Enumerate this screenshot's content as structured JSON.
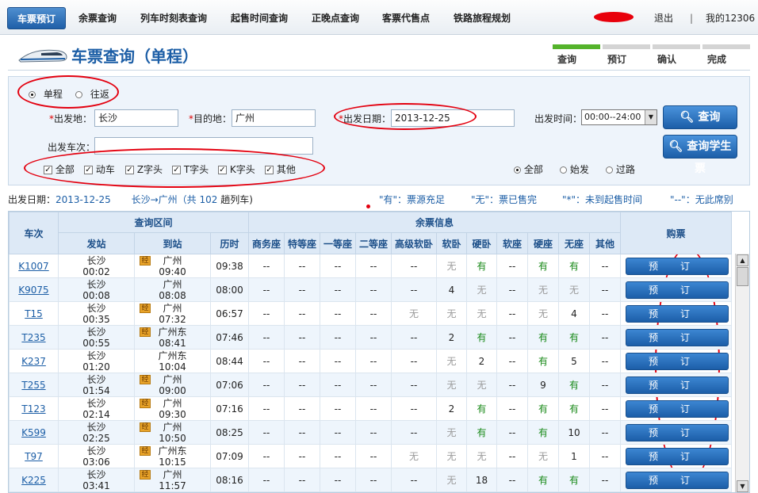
{
  "nav": {
    "items": [
      "车票预订",
      "余票查询",
      "列车时刻表查询",
      "起售时间查询",
      "正晚点查询",
      "客票代售点",
      "铁路旅程规划"
    ],
    "logout": "退出",
    "separator": "|",
    "my12306": "我的12306"
  },
  "page": {
    "title": "车票查询（单程）"
  },
  "steps": [
    "查询",
    "预订",
    "确认",
    "完成"
  ],
  "form": {
    "trip_oneway": "单程",
    "trip_round": "往返",
    "from_label": "出发地：",
    "from_value": "长沙",
    "to_label": "目的地：",
    "to_value": "广州",
    "date_label": "出发日期：",
    "date_value": "2013-12-25",
    "time_label": "出发时间：",
    "time_value": "00:00--24:00",
    "train_no_label": "出发车次：",
    "train_no_value": "",
    "types": [
      "全部",
      "动车",
      "Z字头",
      "T字头",
      "K字头",
      "其他"
    ],
    "station_all": "全部",
    "station_start": "始发",
    "station_pass": "过路",
    "query_button": "查询",
    "student_button": "查询学生票"
  },
  "summary": {
    "date_label": "出发日期：",
    "date": "2013-12-25",
    "route": "长沙→广州（共",
    "count": "102",
    "trains_suffix": "趟列车)"
  },
  "legend": [
    "\"有\"：票源充足",
    "\"无\"：票已售完",
    "\"*\"：未到起售时间",
    "\"--\"：无此席别"
  ],
  "table": {
    "header_query": "查询区间",
    "header_seats": "余票信息",
    "header_train": "车次",
    "header_buy": "购票",
    "cols": [
      "发站",
      "到站",
      "历时",
      "商务座",
      "特等座",
      "一等座",
      "二等座",
      "高级软卧",
      "软卧",
      "硬卧",
      "软座",
      "硬座",
      "无座",
      "其他"
    ],
    "book_label": "预订",
    "via_mark": "经",
    "rows": [
      {
        "no": "K1007",
        "from": "长沙",
        "dep": "00:02",
        "to": "广州",
        "arr": "09:40",
        "dur": "09:38",
        "via": true,
        "seats": [
          "--",
          "--",
          "--",
          "--",
          "--",
          "无",
          "有",
          "--",
          "有",
          "有",
          "--"
        ]
      },
      {
        "no": "K9075",
        "from": "长沙",
        "dep": "00:08",
        "to": "广州",
        "arr": "08:08",
        "dur": "08:00",
        "via": false,
        "seats": [
          "--",
          "--",
          "--",
          "--",
          "--",
          "4",
          "无",
          "--",
          "无",
          "无",
          "--"
        ]
      },
      {
        "no": "T15",
        "from": "长沙",
        "dep": "00:35",
        "to": "广州",
        "arr": "07:32",
        "dur": "06:57",
        "via": true,
        "seats": [
          "--",
          "--",
          "--",
          "--",
          "无",
          "无",
          "无",
          "--",
          "无",
          "4",
          "--"
        ]
      },
      {
        "no": "T235",
        "from": "长沙",
        "dep": "00:55",
        "to": "广州东",
        "arr": "08:41",
        "dur": "07:46",
        "via": true,
        "seats": [
          "--",
          "--",
          "--",
          "--",
          "--",
          "2",
          "有",
          "--",
          "有",
          "有",
          "--"
        ]
      },
      {
        "no": "K237",
        "from": "长沙",
        "dep": "01:20",
        "to": "广州东",
        "arr": "10:04",
        "dur": "08:44",
        "via": false,
        "seats": [
          "--",
          "--",
          "--",
          "--",
          "--",
          "无",
          "2",
          "--",
          "有",
          "5",
          "--"
        ]
      },
      {
        "no": "T255",
        "from": "长沙",
        "dep": "01:54",
        "to": "广州",
        "arr": "09:00",
        "dur": "07:06",
        "via": true,
        "seats": [
          "--",
          "--",
          "--",
          "--",
          "--",
          "无",
          "无",
          "--",
          "9",
          "有",
          "--"
        ]
      },
      {
        "no": "T123",
        "from": "长沙",
        "dep": "02:14",
        "to": "广州",
        "arr": "09:30",
        "dur": "07:16",
        "via": true,
        "seats": [
          "--",
          "--",
          "--",
          "--",
          "--",
          "2",
          "有",
          "--",
          "有",
          "有",
          "--"
        ]
      },
      {
        "no": "K599",
        "from": "长沙",
        "dep": "02:25",
        "to": "广州",
        "arr": "10:50",
        "dur": "08:25",
        "via": true,
        "seats": [
          "--",
          "--",
          "--",
          "--",
          "--",
          "无",
          "有",
          "--",
          "有",
          "10",
          "--"
        ]
      },
      {
        "no": "T97",
        "from": "长沙",
        "dep": "03:06",
        "to": "广州东",
        "arr": "10:15",
        "dur": "07:09",
        "via": true,
        "seats": [
          "--",
          "--",
          "--",
          "--",
          "无",
          "无",
          "无",
          "--",
          "无",
          "1",
          "--"
        ]
      },
      {
        "no": "K225",
        "from": "长沙",
        "dep": "03:41",
        "to": "广州",
        "arr": "11:57",
        "dur": "08:16",
        "via": true,
        "seats": [
          "--",
          "--",
          "--",
          "--",
          "--",
          "无",
          "18",
          "--",
          "有",
          "有",
          "--"
        ]
      }
    ]
  },
  "colors": {
    "accent": "#1c5ea6",
    "annotation": "#e3000f",
    "available": "#1a8a1a",
    "soldout": "#9a9a9a"
  }
}
